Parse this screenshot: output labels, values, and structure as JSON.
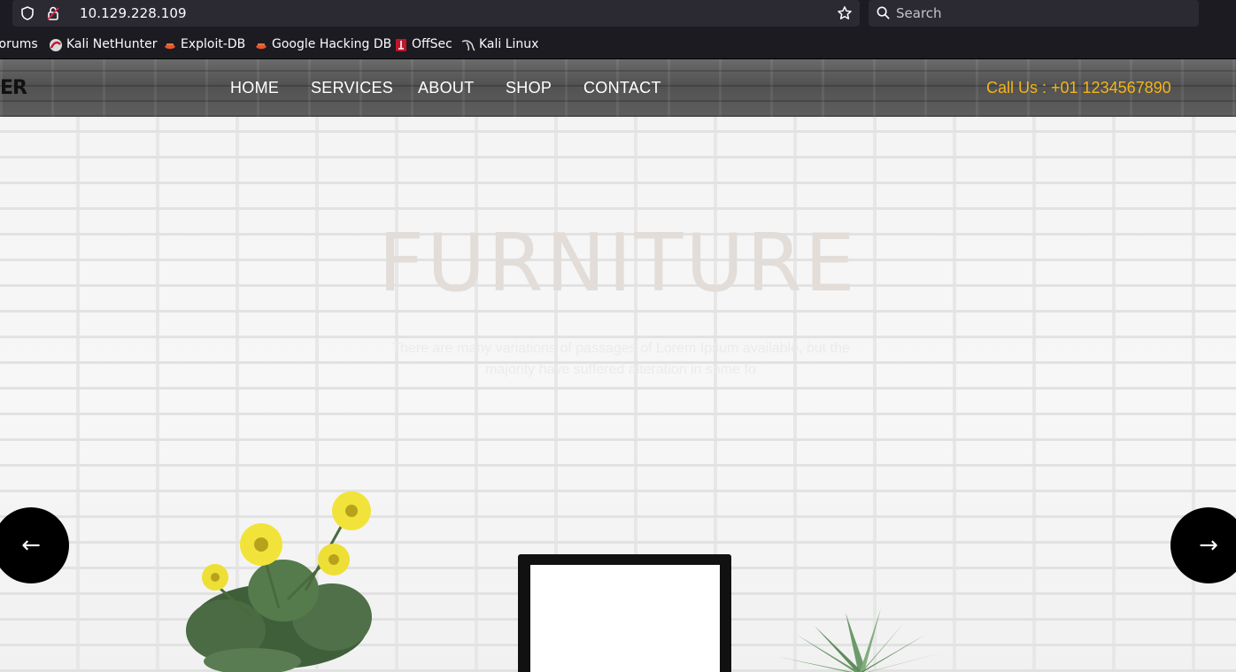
{
  "browser": {
    "url": "10.129.228.109",
    "search_placeholder": "Search",
    "bookmarks": [
      {
        "label": "Forums",
        "icon": "forum-icon"
      },
      {
        "label": "Kali NetHunter",
        "icon": "nethunter-icon"
      },
      {
        "label": "Exploit-DB",
        "icon": "exploitdb-icon"
      },
      {
        "label": "Google Hacking DB",
        "icon": "ghdb-icon"
      },
      {
        "label": "OffSec",
        "icon": "offsec-icon"
      },
      {
        "label": "Kali Linux",
        "icon": "kali-dragon-icon"
      }
    ]
  },
  "site": {
    "logo_fragment": "ER",
    "nav": [
      "HOME",
      "SERVICES",
      "ABOUT",
      "SHOP",
      "CONTACT"
    ],
    "call": "Call Us : +01 1234567890",
    "accent_color": "#f4b41a"
  },
  "hero": {
    "title": "FURNITURE",
    "subtitle": "There are many variations of passages of Lorem Ipsum available, but the majority have suffered alteration in some fo",
    "prev_label": "←",
    "next_label": "→"
  }
}
